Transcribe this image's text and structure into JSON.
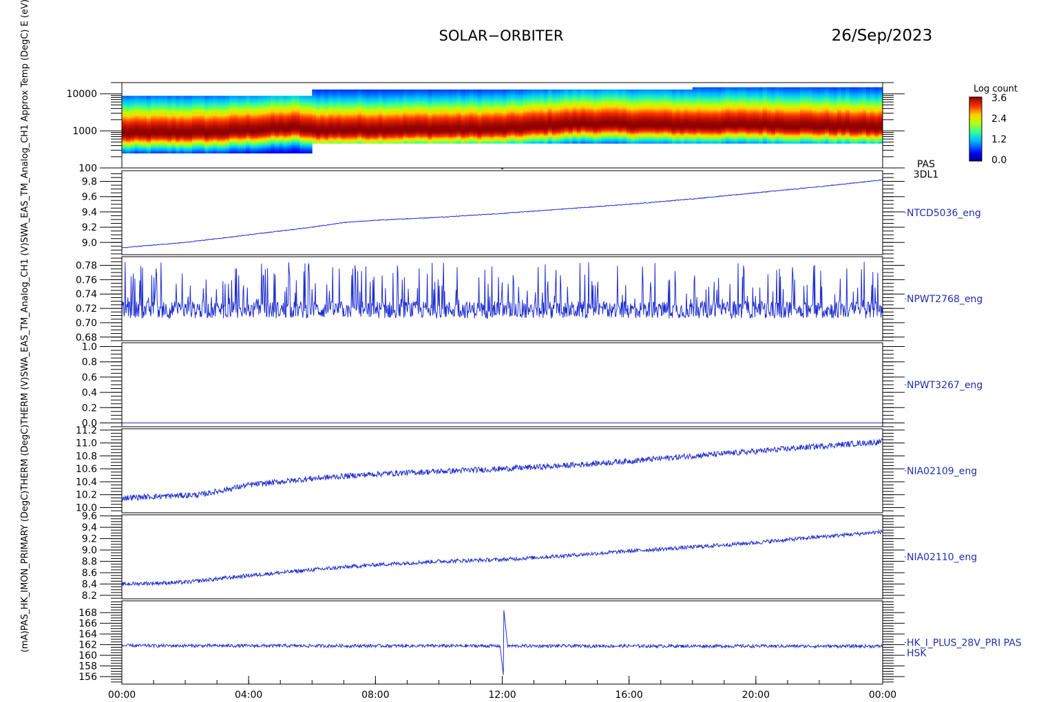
{
  "header": {
    "mission": "SOLAR−ORBITER",
    "date": "26/Sep/2023"
  },
  "colorbar": {
    "title": "Log count",
    "ticks": [
      "3.6",
      "2.4",
      "1.2",
      "0.0"
    ],
    "range": [
      0.0,
      3.6
    ]
  },
  "x_axis": {
    "range_hours": [
      0,
      24
    ],
    "ticks": [
      "00:00",
      "04:00",
      "08:00",
      "12:00",
      "16:00",
      "20:00",
      "00:00"
    ]
  },
  "chart_data": [
    {
      "type": "heatmap",
      "label": [
        "PAS",
        "3DL1"
      ],
      "ylabel": "E (eV)",
      "yscale": "log",
      "ylim": [
        100,
        20000
      ],
      "yticks": [
        "10000",
        "1000",
        "100"
      ],
      "yticks_values": [
        10000,
        1000,
        100
      ],
      "energy_segments": [
        {
          "x": [
            0,
            6
          ],
          "ylim": [
            250,
            8800
          ]
        },
        {
          "x": [
            6,
            18
          ],
          "ylim": [
            460,
            13000
          ]
        },
        {
          "x": [
            18,
            24
          ],
          "ylim": [
            460,
            15000
          ]
        }
      ],
      "peak_energy_eV": [
        {
          "x": 0,
          "y": 850
        },
        {
          "x": 3,
          "y": 900
        },
        {
          "x": 5.5,
          "y": 1200
        },
        {
          "x": 6,
          "y": 1000
        },
        {
          "x": 9,
          "y": 1050
        },
        {
          "x": 12,
          "y": 1100
        },
        {
          "x": 14.5,
          "y": 1500
        },
        {
          "x": 18,
          "y": 1350
        },
        {
          "x": 20,
          "y": 1400
        },
        {
          "x": 24,
          "y": 1200
        }
      ]
    },
    {
      "type": "line",
      "label": [
        "NTCD5036_eng"
      ],
      "ylabel": "Approx Temp (DegC)",
      "ylim": [
        8.84,
        9.94
      ],
      "yticks": [
        "9.8",
        "9.6",
        "9.4",
        "9.2",
        "9.0"
      ],
      "yticks_values": [
        9.8,
        9.6,
        9.4,
        9.2,
        9.0
      ],
      "x": [
        0,
        2,
        4,
        6,
        7,
        8,
        10,
        12,
        14,
        16,
        18,
        20,
        22,
        24
      ],
      "values": [
        8.93,
        9.0,
        9.1,
        9.2,
        9.26,
        9.29,
        9.33,
        9.38,
        9.44,
        9.5,
        9.57,
        9.65,
        9.73,
        9.82
      ],
      "noise": 0.005
    },
    {
      "type": "line",
      "label": [
        "NPWT2768_eng"
      ],
      "ylabel": "SWA_EAS_TM_Analog_CH1 (V)",
      "ylim": [
        0.675,
        0.792
      ],
      "yticks": [
        "0.78",
        "0.76",
        "0.74",
        "0.72",
        "0.70",
        "0.68"
      ],
      "yticks_values": [
        0.78,
        0.76,
        0.74,
        0.72,
        0.7,
        0.68
      ],
      "x": [
        0,
        24
      ],
      "values": [
        0.718,
        0.718
      ],
      "noise": 0.012,
      "spike_up_max": 0.785
    },
    {
      "type": "line",
      "label": [
        "NPWT3267_eng"
      ],
      "ylabel": "SWA_EAS_TM_Analog_CH1 (V)",
      "ylim": [
        -0.05,
        1.05
      ],
      "yticks": [
        "1.0",
        "0.8",
        "0.6",
        "0.4",
        "0.2",
        "0.0"
      ],
      "yticks_values": [
        1.0,
        0.8,
        0.6,
        0.4,
        0.2,
        0.0
      ],
      "x": [
        0,
        24
      ],
      "values": [
        0.0,
        0.0
      ],
      "noise": 0.0
    },
    {
      "type": "line",
      "label": [
        "NIA02109_eng"
      ],
      "ylabel": "THERM (DegC)",
      "ylim": [
        9.92,
        11.22
      ],
      "yticks": [
        "11.2",
        "11.0",
        "10.8",
        "10.6",
        "10.4",
        "10.2",
        "10.0"
      ],
      "yticks_values": [
        11.2,
        11.0,
        10.8,
        10.6,
        10.4,
        10.2,
        10.0
      ],
      "x": [
        0,
        2.5,
        4,
        6,
        8,
        10,
        12,
        14,
        16,
        18,
        20,
        22,
        24
      ],
      "values": [
        10.15,
        10.2,
        10.35,
        10.45,
        10.52,
        10.56,
        10.6,
        10.65,
        10.72,
        10.8,
        10.87,
        10.95,
        11.02
      ],
      "noise": 0.045
    },
    {
      "type": "line",
      "label": [
        "NIA02110_eng"
      ],
      "ylabel": "THERM (DegC)",
      "ylim": [
        8.14,
        9.62
      ],
      "yticks": [
        "9.6",
        "9.4",
        "9.2",
        "9.0",
        "8.8",
        "8.6",
        "8.4",
        "8.2"
      ],
      "yticks_values": [
        9.6,
        9.4,
        9.2,
        9.0,
        8.8,
        8.6,
        8.4,
        8.2
      ],
      "x": [
        0,
        2,
        4,
        6,
        8,
        10,
        12,
        14,
        16,
        18,
        20,
        22,
        24
      ],
      "values": [
        8.4,
        8.43,
        8.55,
        8.65,
        8.74,
        8.8,
        8.83,
        8.9,
        8.98,
        9.05,
        9.13,
        9.23,
        9.32
      ],
      "noise": 0.035
    },
    {
      "type": "line",
      "label": [
        "HK_I_PLUS_28V_PRI PAS",
        "HSK"
      ],
      "ylabel": "PAS_HK_IMON_PRIMARY (mA)",
      "ylim": [
        154.6,
        170.2
      ],
      "yticks": [
        "168",
        "166",
        "164",
        "162",
        "160",
        "158",
        "156"
      ],
      "yticks_values": [
        168,
        166,
        164,
        162,
        160,
        158,
        156
      ],
      "x": [
        0,
        24
      ],
      "values": [
        161.8,
        161.7
      ],
      "noise": 0.3,
      "spike": {
        "x": 12.05,
        "min": 155.5,
        "max": 168.5
      }
    }
  ],
  "left_label_text": "(mA)PAS_HK_IMON_PRIMARY (DegC)THERM (DegC)THERM (V)SWA_EAS_TM_Analog_CH1 (V)SWA_EAS_TM_Analog_CH1 Approx Temp (DegC) E (eV)"
}
